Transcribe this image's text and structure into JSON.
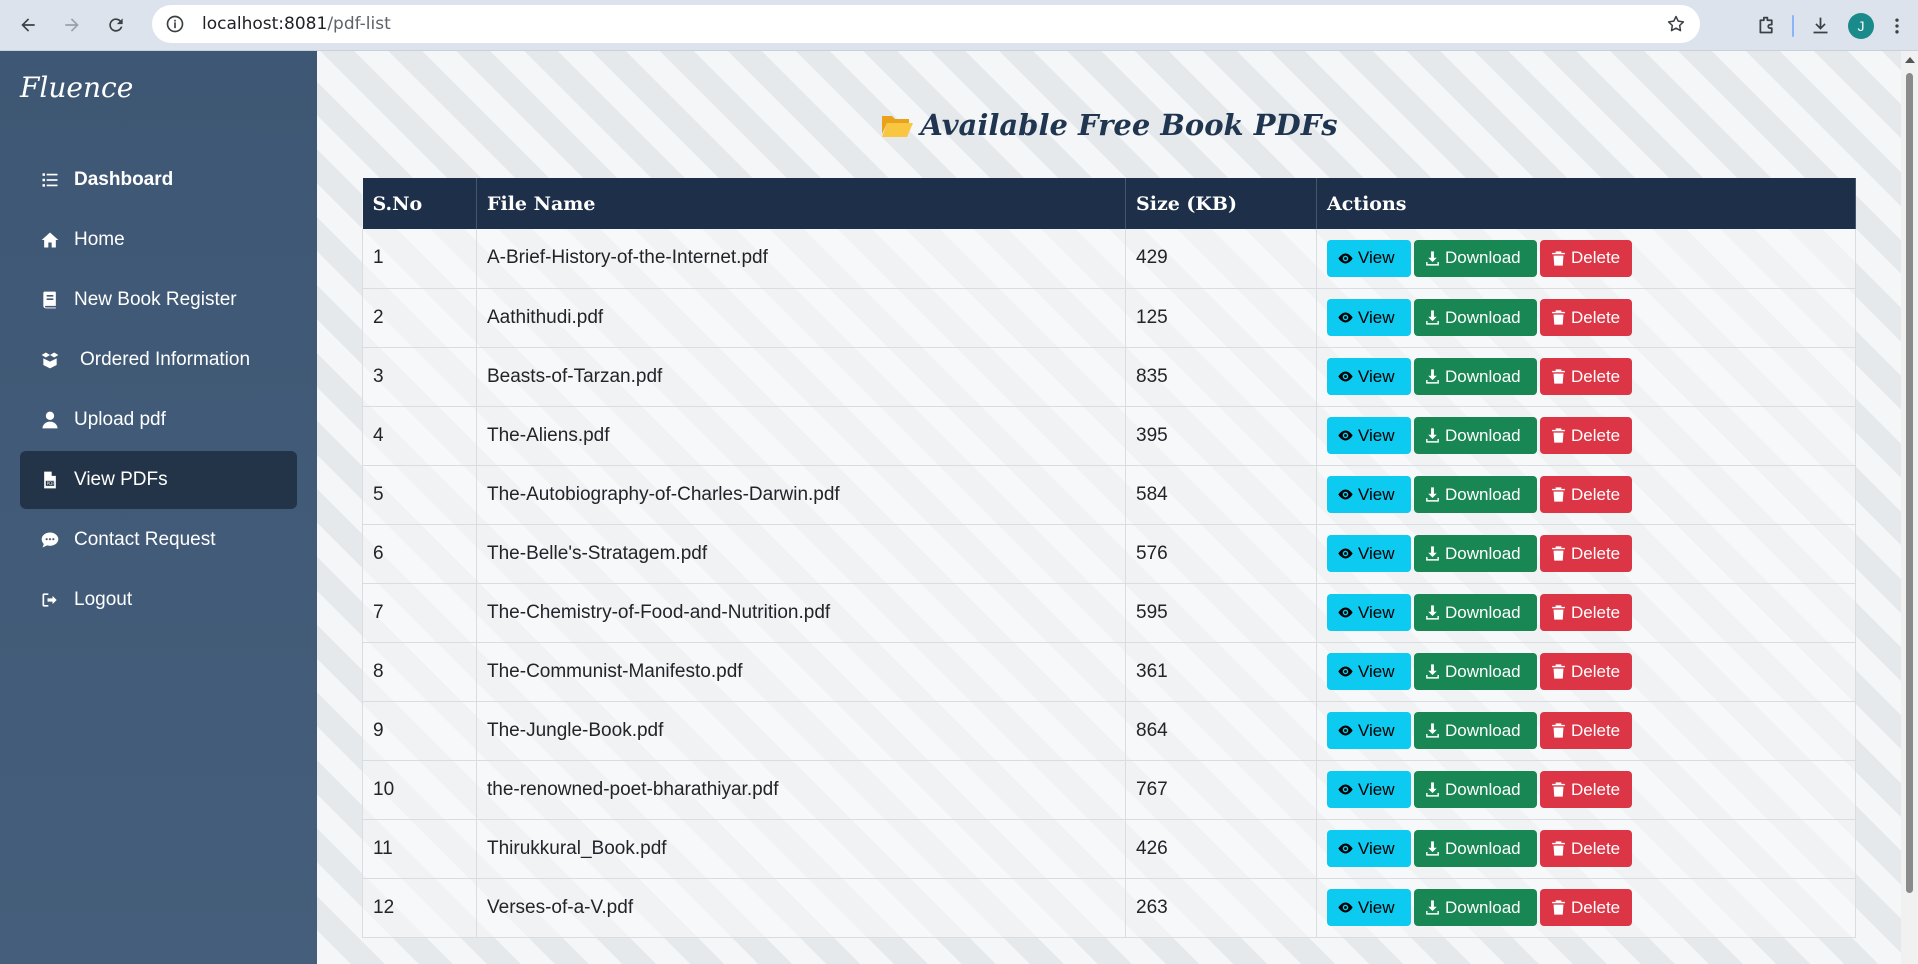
{
  "browser": {
    "url_host": "localhost:8081",
    "url_path": "/pdf-list",
    "profile_initial": "J"
  },
  "sidebar": {
    "brand": "Fluence",
    "items": [
      {
        "label": "Dashboard",
        "icon": "list-icon"
      },
      {
        "label": "Home",
        "icon": "home-icon"
      },
      {
        "label": "New Book Register",
        "icon": "book-icon"
      },
      {
        "label": "Ordered Information",
        "icon": "box-icon"
      },
      {
        "label": "Upload pdf",
        "icon": "user-icon"
      },
      {
        "label": "View PDFs",
        "icon": "pdf-file-icon",
        "active": true
      },
      {
        "label": "Contact Request",
        "icon": "chat-icon"
      },
      {
        "label": "Logout",
        "icon": "logout-icon"
      }
    ]
  },
  "main": {
    "title": "Available Free Book PDFs",
    "headers": {
      "sno": "S.No",
      "name": "File Name",
      "size": "Size (KB)",
      "actions": "Actions"
    },
    "buttons": {
      "view": "View",
      "download": "Download",
      "delete": "Delete"
    },
    "rows": [
      {
        "sno": "1",
        "name": "A-Brief-History-of-the-Internet.pdf",
        "size": "429"
      },
      {
        "sno": "2",
        "name": "Aathithudi.pdf",
        "size": "125"
      },
      {
        "sno": "3",
        "name": "Beasts-of-Tarzan.pdf",
        "size": "835"
      },
      {
        "sno": "4",
        "name": "The-Aliens.pdf",
        "size": "395"
      },
      {
        "sno": "5",
        "name": "The-Autobiography-of-Charles-Darwin.pdf",
        "size": "584"
      },
      {
        "sno": "6",
        "name": "The-Belle's-Stratagem.pdf",
        "size": "576"
      },
      {
        "sno": "7",
        "name": "The-Chemistry-of-Food-and-Nutrition.pdf",
        "size": "595"
      },
      {
        "sno": "8",
        "name": "The-Communist-Manifesto.pdf",
        "size": "361"
      },
      {
        "sno": "9",
        "name": "The-Jungle-Book.pdf",
        "size": "864"
      },
      {
        "sno": "10",
        "name": "the-renowned-poet-bharathiyar.pdf",
        "size": "767"
      },
      {
        "sno": "11",
        "name": "Thirukkural_Book.pdf",
        "size": "426"
      },
      {
        "sno": "12",
        "name": "Verses-of-a-V.pdf",
        "size": "263"
      }
    ]
  },
  "colors": {
    "sidebar": "#3e5774",
    "sidebar_active": "#243448",
    "table_header": "#1e3049",
    "view": "#0dcaf0",
    "download": "#198754",
    "delete": "#dc3545"
  }
}
